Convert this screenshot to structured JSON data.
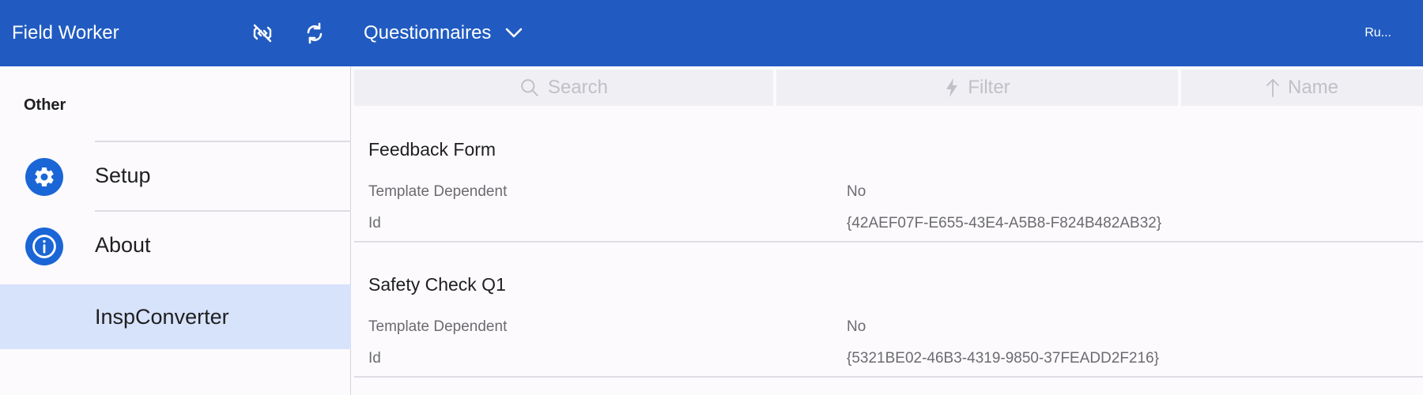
{
  "header": {
    "app_title": "Field Worker",
    "nav_label": "Questionnaires",
    "user_short": "Ru..."
  },
  "sidebar": {
    "heading": "Other",
    "items": [
      {
        "label": "Setup",
        "icon": "gear-icon"
      },
      {
        "label": "About",
        "icon": "info-icon"
      },
      {
        "label": "InspConverter",
        "icon": ""
      }
    ],
    "active_index": 2
  },
  "toolbar": {
    "search_label": "Search",
    "filter_label": "Filter",
    "sort_label": "Name"
  },
  "records": [
    {
      "title": "Feedback Form",
      "fields": [
        {
          "label": "Template Dependent",
          "value": "No"
        },
        {
          "label": "Id",
          "value": "{42AEF07F-E655-43E4-A5B8-F824B482AB32}"
        }
      ]
    },
    {
      "title": "Safety Check Q1",
      "fields": [
        {
          "label": "Template Dependent",
          "value": "No"
        },
        {
          "label": "Id",
          "value": "{5321BE02-46B3-4319-9850-37FEADD2F216}"
        }
      ]
    }
  ],
  "colors": {
    "header_bg": "#215bc1",
    "icon_circle": "#1b66d6",
    "active_item_bg": "#d7e2fb"
  }
}
